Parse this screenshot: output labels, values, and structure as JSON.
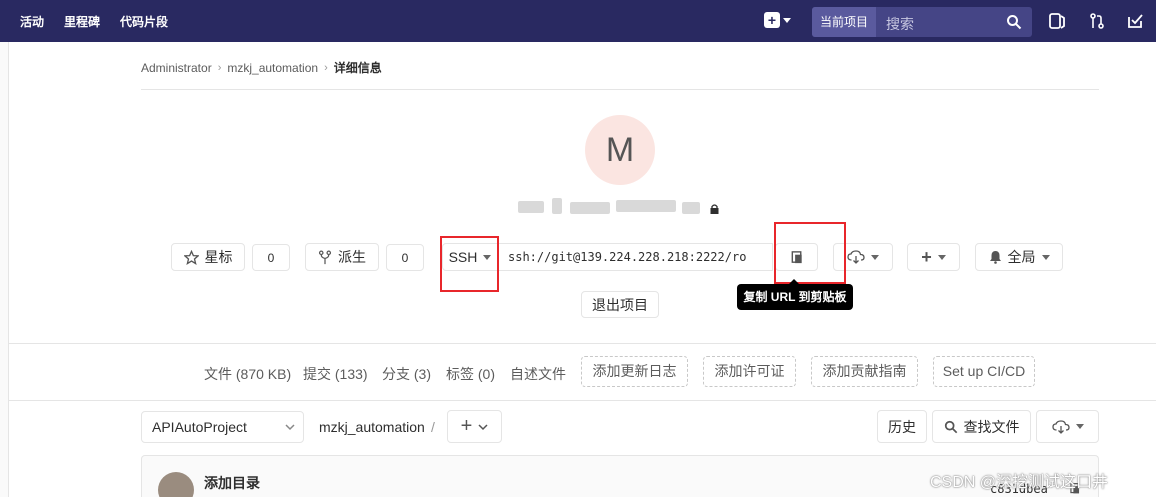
{
  "nav": {
    "activity": "活动",
    "milestones": "里程碑",
    "snippets": "代码片段",
    "scope": "当前项目",
    "search_placeholder": "搜索"
  },
  "breadcrumb": {
    "owner": "Administrator",
    "project": "mzkj_automation",
    "current": "详细信息"
  },
  "project": {
    "avatar_letter": "M"
  },
  "actions": {
    "star": "星标",
    "star_count": "0",
    "fork": "派生",
    "fork_count": "0",
    "protocol": "SSH",
    "clone_url": "ssh://git@139.224.228.218:2222/ro",
    "copy_tooltip": "复制 URL 到剪贴板",
    "notification": "全局",
    "leave_project": "退出项目"
  },
  "stats": {
    "files": "文件 (870 KB)",
    "commits": "提交 (133)",
    "branches": "分支 (3)",
    "tags": "标签 (0)",
    "readme": "自述文件",
    "add_changelog": "添加更新日志",
    "add_license": "添加许可证",
    "add_contributing": "添加贡献指南",
    "setup_cicd": "Set up CI/CD"
  },
  "tree": {
    "branch": "APIAutoProject",
    "path": "mzkj_automation",
    "path_sep": "/",
    "history": "历史",
    "find_file": "查找文件"
  },
  "commit": {
    "title": "添加目录",
    "sha": "c831dbea"
  },
  "watermark": "CSDN @深挖测试这口井",
  "colors": {
    "navbar": "#292961",
    "highlight_box": "#e8262b",
    "avatar_bg": "#fbe5e1"
  }
}
